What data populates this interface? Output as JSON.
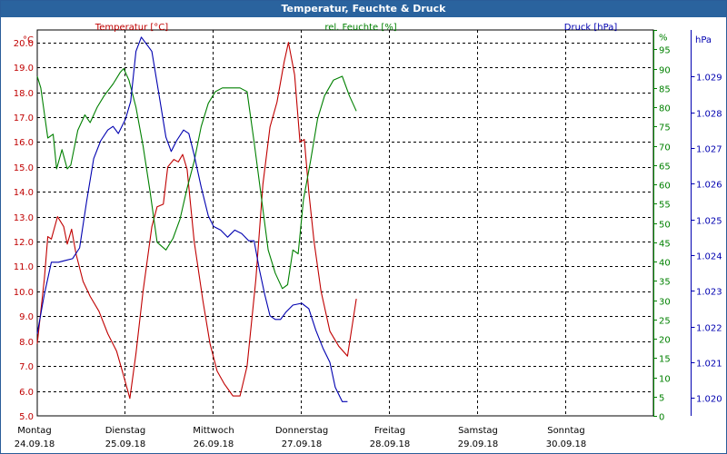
{
  "window": {
    "title": "Temperatur, Feuchte & Druck"
  },
  "colors": {
    "temperature": "#c00000",
    "humidity": "#008000",
    "pressure": "#0000b0",
    "titlebar": "#2a639e",
    "grid": "#000000"
  },
  "chart_data": {
    "type": "line",
    "title": "Temperatur, Feuchte & Druck",
    "grid": true,
    "x_ticks": [
      {
        "day": "Montag",
        "date": "24.09.18"
      },
      {
        "day": "Dienstag",
        "date": "25.09.18"
      },
      {
        "day": "Mittwoch",
        "date": "26.09.18"
      },
      {
        "day": "Donnerstag",
        "date": "27.09.18"
      },
      {
        "day": "Freitag",
        "date": "28.09.18"
      },
      {
        "day": "Samstag",
        "date": "29.09.18"
      },
      {
        "day": "Sonntag",
        "date": "30.09.18"
      }
    ],
    "xlim": [
      0,
      7
    ],
    "axes": {
      "temperature": {
        "label": "Temperatur [°C]",
        "unit": "°C",
        "ylim": [
          5.0,
          20.5
        ],
        "ticks": [
          "5.0",
          "6.0",
          "7.0",
          "8.0",
          "9.0",
          "10.0",
          "11.0",
          "12.0",
          "13.0",
          "14.0",
          "15.0",
          "16.0",
          "17.0",
          "18.0",
          "19.0",
          "20.0"
        ]
      },
      "humidity": {
        "label": "rel. Feuchte [%]",
        "unit": "%",
        "ylim": [
          0,
          100
        ],
        "ticks": [
          "0",
          "5",
          "10",
          "15",
          "20",
          "25",
          "30",
          "35",
          "40",
          "45",
          "50",
          "55",
          "60",
          "65",
          "70",
          "75",
          "80",
          "85",
          "90",
          "95",
          "%"
        ]
      },
      "pressure": {
        "label": "Druck [hPa]",
        "unit": "hPa",
        "ylim": [
          1.0195,
          1.0303
        ],
        "ticks": [
          "1.020",
          "1.021",
          "1.022",
          "1.023",
          "1.024",
          "1.025",
          "1.026",
          "1.027",
          "1.028",
          "1.029"
        ]
      }
    },
    "series": [
      {
        "name": "Temperatur [°C]",
        "axis": "temperature",
        "points": [
          [
            0.0,
            7.9
          ],
          [
            0.08,
            10.5
          ],
          [
            0.12,
            12.2
          ],
          [
            0.16,
            12.1
          ],
          [
            0.23,
            13.0
          ],
          [
            0.3,
            12.6
          ],
          [
            0.34,
            11.9
          ],
          [
            0.39,
            12.5
          ],
          [
            0.44,
            11.5
          ],
          [
            0.52,
            10.4
          ],
          [
            0.6,
            9.8
          ],
          [
            0.7,
            9.2
          ],
          [
            0.8,
            8.3
          ],
          [
            0.9,
            7.6
          ],
          [
            0.98,
            6.6
          ],
          [
            1.05,
            5.7
          ],
          [
            1.12,
            7.5
          ],
          [
            1.2,
            10.0
          ],
          [
            1.3,
            12.6
          ],
          [
            1.36,
            13.4
          ],
          [
            1.43,
            13.5
          ],
          [
            1.48,
            15.0
          ],
          [
            1.55,
            15.3
          ],
          [
            1.6,
            15.2
          ],
          [
            1.65,
            15.5
          ],
          [
            1.7,
            14.9
          ],
          [
            1.78,
            12.0
          ],
          [
            1.88,
            9.6
          ],
          [
            1.96,
            7.9
          ],
          [
            2.04,
            6.8
          ],
          [
            2.12,
            6.3
          ],
          [
            2.22,
            5.8
          ],
          [
            2.3,
            5.8
          ],
          [
            2.38,
            7.0
          ],
          [
            2.48,
            10.5
          ],
          [
            2.56,
            14.3
          ],
          [
            2.64,
            16.6
          ],
          [
            2.72,
            17.6
          ],
          [
            2.8,
            19.2
          ],
          [
            2.85,
            20.0
          ],
          [
            2.92,
            18.7
          ],
          [
            2.98,
            16.0
          ],
          [
            3.03,
            16.1
          ],
          [
            3.08,
            14.0
          ],
          [
            3.14,
            12.0
          ],
          [
            3.22,
            10.0
          ],
          [
            3.32,
            8.4
          ],
          [
            3.42,
            7.8
          ],
          [
            3.52,
            7.4
          ],
          [
            3.62,
            9.7
          ]
        ]
      },
      {
        "name": "rel. Feuchte [%]",
        "axis": "humidity",
        "points": [
          [
            0.0,
            88
          ],
          [
            0.04,
            85
          ],
          [
            0.12,
            72
          ],
          [
            0.18,
            73
          ],
          [
            0.22,
            64
          ],
          [
            0.28,
            69
          ],
          [
            0.34,
            64
          ],
          [
            0.38,
            65
          ],
          [
            0.46,
            74
          ],
          [
            0.54,
            78
          ],
          [
            0.6,
            76
          ],
          [
            0.68,
            80
          ],
          [
            0.76,
            83
          ],
          [
            0.86,
            86
          ],
          [
            0.94,
            89
          ],
          [
            0.98,
            90
          ],
          [
            1.04,
            87
          ],
          [
            1.12,
            80
          ],
          [
            1.2,
            70
          ],
          [
            1.28,
            58
          ],
          [
            1.36,
            45
          ],
          [
            1.46,
            43
          ],
          [
            1.54,
            46
          ],
          [
            1.62,
            51
          ],
          [
            1.7,
            59
          ],
          [
            1.78,
            66
          ],
          [
            1.86,
            75
          ],
          [
            1.94,
            81
          ],
          [
            2.02,
            84
          ],
          [
            2.1,
            85
          ],
          [
            2.2,
            85
          ],
          [
            2.3,
            85
          ],
          [
            2.38,
            84
          ],
          [
            2.46,
            71
          ],
          [
            2.54,
            57
          ],
          [
            2.62,
            43
          ],
          [
            2.7,
            37
          ],
          [
            2.78,
            33
          ],
          [
            2.84,
            34
          ],
          [
            2.9,
            43
          ],
          [
            2.96,
            42
          ],
          [
            3.02,
            56
          ],
          [
            3.1,
            66
          ],
          [
            3.18,
            77
          ],
          [
            3.26,
            83
          ],
          [
            3.36,
            87
          ],
          [
            3.46,
            88
          ],
          [
            3.54,
            83
          ],
          [
            3.62,
            79
          ]
        ]
      },
      {
        "name": "Druck [hPa]",
        "axis": "pressure",
        "points": [
          [
            0.0,
            1.0218
          ],
          [
            0.08,
            1.0229
          ],
          [
            0.16,
            1.0238
          ],
          [
            0.24,
            1.0238
          ],
          [
            0.32,
            1.02385
          ],
          [
            0.4,
            1.0239
          ],
          [
            0.48,
            1.0242
          ],
          [
            0.56,
            1.0255
          ],
          [
            0.64,
            1.0267
          ],
          [
            0.72,
            1.0272
          ],
          [
            0.8,
            1.0275
          ],
          [
            0.86,
            1.0276
          ],
          [
            0.92,
            1.0274
          ],
          [
            1.0,
            1.0278
          ],
          [
            1.06,
            1.0283
          ],
          [
            1.12,
            1.0297
          ],
          [
            1.18,
            1.0301
          ],
          [
            1.24,
            1.0299
          ],
          [
            1.3,
            1.0297
          ],
          [
            1.38,
            1.0285
          ],
          [
            1.46,
            1.0273
          ],
          [
            1.52,
            1.0269
          ],
          [
            1.58,
            1.0272
          ],
          [
            1.66,
            1.0275
          ],
          [
            1.72,
            1.0274
          ],
          [
            1.78,
            1.0268
          ],
          [
            1.86,
            1.0259
          ],
          [
            1.94,
            1.0251
          ],
          [
            2.0,
            1.0248
          ],
          [
            2.08,
            1.0247
          ],
          [
            2.16,
            1.0245
          ],
          [
            2.24,
            1.0247
          ],
          [
            2.32,
            1.0246
          ],
          [
            2.4,
            1.0244
          ],
          [
            2.46,
            1.0244
          ],
          [
            2.52,
            1.0236
          ],
          [
            2.58,
            1.0229
          ],
          [
            2.64,
            1.0223
          ],
          [
            2.7,
            1.0222
          ],
          [
            2.76,
            1.0222
          ],
          [
            2.82,
            1.0224
          ],
          [
            2.9,
            1.0226
          ],
          [
            3.0,
            1.02265
          ],
          [
            3.08,
            1.0225
          ],
          [
            3.16,
            1.0219
          ],
          [
            3.24,
            1.0214
          ],
          [
            3.32,
            1.021
          ],
          [
            3.38,
            1.0203
          ],
          [
            3.46,
            1.0199
          ],
          [
            3.52,
            1.0199
          ]
        ]
      }
    ]
  }
}
